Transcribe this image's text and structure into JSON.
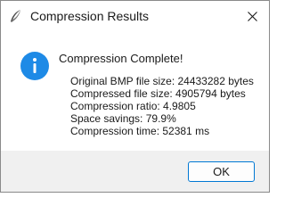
{
  "window": {
    "title": "Compression Results",
    "app_icon": "feather-icon",
    "close_icon": "close-icon"
  },
  "message": {
    "icon": "info-icon",
    "heading": "Compression Complete!",
    "lines": [
      "Original BMP file size: 24433282 bytes",
      "Compressed file size: 4905794 bytes",
      "Compression ratio: 4.9805",
      "Space savings: 79.9%",
      "Compression time: 52381 ms"
    ]
  },
  "buttons": {
    "ok_label": "OK"
  },
  "colors": {
    "info_blue": "#1e8ae6",
    "button_border": "#0078d4",
    "footer_bg": "#f0f0f0"
  }
}
